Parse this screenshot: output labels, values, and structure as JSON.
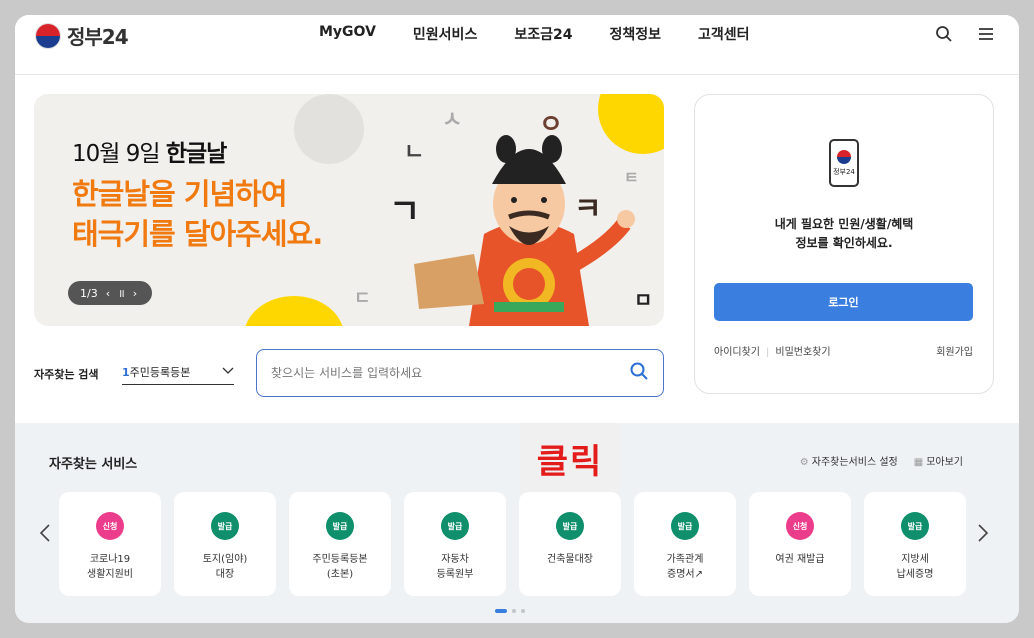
{
  "header": {
    "logo_text": "정부24",
    "nav": [
      "MyGOV",
      "민원서비스",
      "보조금24",
      "정책정보",
      "고객센터"
    ],
    "search_icon": "search-icon",
    "menu_icon": "hamburger-menu-icon"
  },
  "banner": {
    "date_prefix": "10월 9일 ",
    "date_bold": "한글날",
    "line1": "한글날을 기념하여",
    "line2": "태극기를 달아주세요.",
    "pager": "1/3",
    "prev": "‹",
    "pause": "॥",
    "next": "›"
  },
  "search": {
    "label": "자주찾는 검색",
    "select_num": "1",
    "select_text": "주민등록등본",
    "placeholder": "찾으시는 서비스를 입력하세요"
  },
  "login": {
    "phone_label": "정부24",
    "msg1": "내게 필요한 민원/생활/혜택",
    "msg2": "정보를 확인하세요.",
    "button": "로그인",
    "find_id": "아이디찾기",
    "find_pw": "비밀번호찾기",
    "signup": "회원가입"
  },
  "services": {
    "title": "자주찾는 서비스",
    "click_tag": "클릭",
    "settings": "자주찾는서비스 설정",
    "view_all": "모아보기",
    "items": [
      {
        "badge": "신청",
        "name": "코로나19\n생활지원비",
        "color": "#ec3d8c"
      },
      {
        "badge": "발급",
        "name": "토지(임야)\n대장",
        "color": "#0f8f6b"
      },
      {
        "badge": "발급",
        "name": "주민등록등본\n(초본)",
        "color": "#0f8f6b"
      },
      {
        "badge": "발급",
        "name": "자동차\n등록원부",
        "color": "#0f8f6b"
      },
      {
        "badge": "발급",
        "name": "건축물대장",
        "color": "#0f8f6b"
      },
      {
        "badge": "발급",
        "name": "가족관계\n증명서↗",
        "color": "#0f8f6b"
      },
      {
        "badge": "신청",
        "name": "여권 재발급",
        "color": "#ec3d8c"
      },
      {
        "badge": "발급",
        "name": "지방세\n납세증명",
        "color": "#0f8f6b"
      }
    ],
    "colors": {
      "apply": "#ec3d8c",
      "issue": "#0f8f6b",
      "accent": "#3a7ee0"
    }
  }
}
